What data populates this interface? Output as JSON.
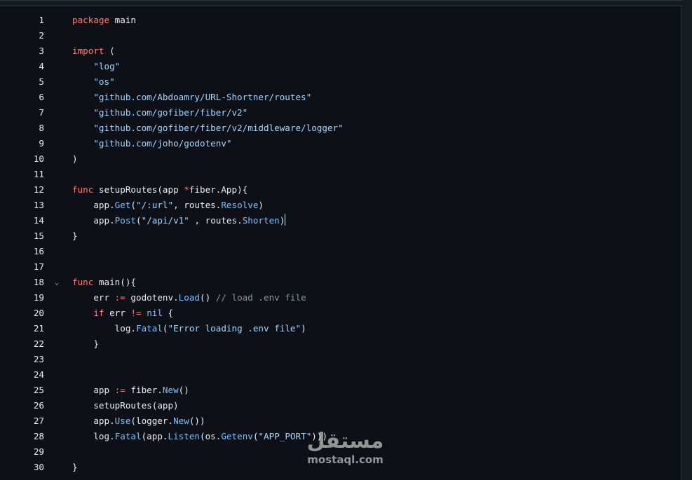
{
  "editor": {
    "lines": [
      {
        "num": "1",
        "tokens": [
          {
            "t": "package",
            "c": "kw"
          },
          {
            "t": " main",
            "c": "plain"
          }
        ]
      },
      {
        "num": "2",
        "tokens": []
      },
      {
        "num": "3",
        "tokens": [
          {
            "t": "import",
            "c": "kw"
          },
          {
            "t": " (",
            "c": "plain"
          }
        ]
      },
      {
        "num": "4",
        "tokens": [
          {
            "t": "    ",
            "c": "plain"
          },
          {
            "t": "\"log\"",
            "c": "str"
          }
        ]
      },
      {
        "num": "5",
        "tokens": [
          {
            "t": "    ",
            "c": "plain"
          },
          {
            "t": "\"os\"",
            "c": "str"
          }
        ]
      },
      {
        "num": "6",
        "tokens": [
          {
            "t": "    ",
            "c": "plain"
          },
          {
            "t": "\"github.com/Abdoamry/URL-Shortner/routes\"",
            "c": "str"
          }
        ]
      },
      {
        "num": "7",
        "tokens": [
          {
            "t": "    ",
            "c": "plain"
          },
          {
            "t": "\"github.com/gofiber/fiber/v2\"",
            "c": "str"
          }
        ]
      },
      {
        "num": "8",
        "tokens": [
          {
            "t": "    ",
            "c": "plain"
          },
          {
            "t": "\"github.com/gofiber/fiber/v2/middleware/logger\"",
            "c": "str"
          }
        ]
      },
      {
        "num": "9",
        "tokens": [
          {
            "t": "    ",
            "c": "plain"
          },
          {
            "t": "\"github.com/joho/godotenv\"",
            "c": "str"
          }
        ]
      },
      {
        "num": "10",
        "tokens": [
          {
            "t": ")",
            "c": "plain"
          }
        ]
      },
      {
        "num": "11",
        "tokens": []
      },
      {
        "num": "12",
        "tokens": [
          {
            "t": "func",
            "c": "kw"
          },
          {
            "t": " setupRoutes(app ",
            "c": "plain"
          },
          {
            "t": "*",
            "c": "op"
          },
          {
            "t": "fiber.App){",
            "c": "plain"
          }
        ]
      },
      {
        "num": "13",
        "tokens": [
          {
            "t": "    app.",
            "c": "plain"
          },
          {
            "t": "Get",
            "c": "prop"
          },
          {
            "t": "(",
            "c": "plain"
          },
          {
            "t": "\"/:url\"",
            "c": "str"
          },
          {
            "t": ", routes.",
            "c": "plain"
          },
          {
            "t": "Resolve",
            "c": "prop"
          },
          {
            "t": ")",
            "c": "plain"
          }
        ]
      },
      {
        "num": "14",
        "tokens": [
          {
            "t": "    app.",
            "c": "plain"
          },
          {
            "t": "Post",
            "c": "prop"
          },
          {
            "t": "(",
            "c": "plain"
          },
          {
            "t": "\"/api/v1\"",
            "c": "str"
          },
          {
            "t": " , routes.",
            "c": "plain"
          },
          {
            "t": "Shorten",
            "c": "prop"
          },
          {
            "t": ")",
            "c": "plain"
          }
        ],
        "cursor": true
      },
      {
        "num": "15",
        "tokens": [
          {
            "t": "}",
            "c": "plain"
          }
        ]
      },
      {
        "num": "16",
        "tokens": []
      },
      {
        "num": "17",
        "tokens": []
      },
      {
        "num": "18",
        "tokens": [
          {
            "t": "func",
            "c": "kw"
          },
          {
            "t": " main(){",
            "c": "plain"
          }
        ],
        "fold": "⌄"
      },
      {
        "num": "19",
        "tokens": [
          {
            "t": "    err ",
            "c": "plain"
          },
          {
            "t": ":=",
            "c": "op"
          },
          {
            "t": " godotenv.",
            "c": "plain"
          },
          {
            "t": "Load",
            "c": "prop"
          },
          {
            "t": "() ",
            "c": "plain"
          },
          {
            "t": "// load .env file",
            "c": "cm"
          }
        ]
      },
      {
        "num": "20",
        "tokens": [
          {
            "t": "    ",
            "c": "plain"
          },
          {
            "t": "if",
            "c": "kw"
          },
          {
            "t": " err ",
            "c": "plain"
          },
          {
            "t": "!=",
            "c": "op"
          },
          {
            "t": " ",
            "c": "plain"
          },
          {
            "t": "nil",
            "c": "prop"
          },
          {
            "t": " {",
            "c": "plain"
          }
        ]
      },
      {
        "num": "21",
        "tokens": [
          {
            "t": "        log.",
            "c": "plain"
          },
          {
            "t": "Fatal",
            "c": "prop"
          },
          {
            "t": "(",
            "c": "plain"
          },
          {
            "t": "\"Error loading .env file\"",
            "c": "str"
          },
          {
            "t": ")",
            "c": "plain"
          }
        ]
      },
      {
        "num": "22",
        "tokens": [
          {
            "t": "    }",
            "c": "plain"
          }
        ]
      },
      {
        "num": "23",
        "tokens": []
      },
      {
        "num": "24",
        "tokens": []
      },
      {
        "num": "25",
        "tokens": [
          {
            "t": "    app ",
            "c": "plain"
          },
          {
            "t": ":=",
            "c": "op"
          },
          {
            "t": " fiber.",
            "c": "plain"
          },
          {
            "t": "New",
            "c": "prop"
          },
          {
            "t": "()",
            "c": "plain"
          }
        ]
      },
      {
        "num": "26",
        "tokens": [
          {
            "t": "    setupRoutes(app)",
            "c": "plain"
          }
        ]
      },
      {
        "num": "27",
        "tokens": [
          {
            "t": "    app.",
            "c": "plain"
          },
          {
            "t": "Use",
            "c": "prop"
          },
          {
            "t": "(logger.",
            "c": "plain"
          },
          {
            "t": "New",
            "c": "prop"
          },
          {
            "t": "())",
            "c": "plain"
          }
        ]
      },
      {
        "num": "28",
        "tokens": [
          {
            "t": "    log.",
            "c": "plain"
          },
          {
            "t": "Fatal",
            "c": "prop"
          },
          {
            "t": "(app.",
            "c": "plain"
          },
          {
            "t": "Listen",
            "c": "prop"
          },
          {
            "t": "(os.",
            "c": "plain"
          },
          {
            "t": "Getenv",
            "c": "prop"
          },
          {
            "t": "(",
            "c": "plain"
          },
          {
            "t": "\"APP_PORT\"",
            "c": "str"
          },
          {
            "t": ")))",
            "c": "plain"
          }
        ]
      },
      {
        "num": "29",
        "tokens": []
      },
      {
        "num": "30",
        "tokens": [
          {
            "t": "}",
            "c": "plain"
          }
        ]
      }
    ]
  },
  "watermark": {
    "arabic": "مستقل",
    "latin": "mostaql.com"
  }
}
